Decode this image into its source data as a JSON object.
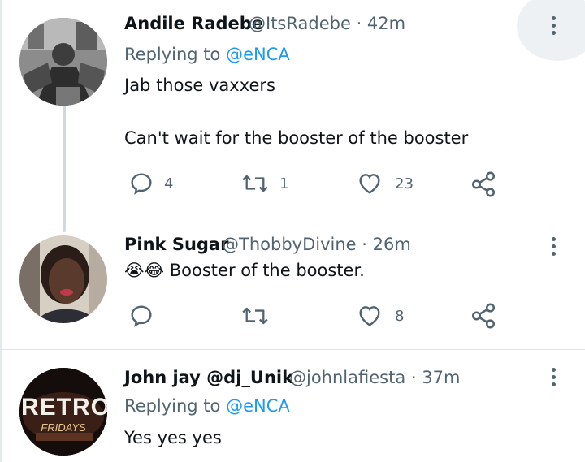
{
  "colors": {
    "text": "#0f1419",
    "secondary": "#536471",
    "link": "#1d9bf0",
    "divider": "#dfe4e7"
  },
  "tweets": [
    {
      "name": "Andile Radebe",
      "handle": "@ItsRadebe",
      "time": "· 42m",
      "replying_label": "Replying to",
      "replying_to": "@eNCA",
      "lines": [
        "Jab those vaxxers",
        "Can't wait for the booster of the booster"
      ],
      "reply_count": "4",
      "retweet_count": "1",
      "like_count": "23"
    },
    {
      "name": "Pink Sugar",
      "handle": "@ThobbyDivine",
      "time": "· 26m",
      "emoji": "😭😂",
      "text": "Booster of the booster.",
      "like_count": "8"
    },
    {
      "name": "John jay @dj_Unik",
      "handle": "@johnlafiesta",
      "time": "· 37m",
      "replying_label": "Replying to",
      "replying_to": "@eNCA",
      "text": "Yes yes yes",
      "avatar_text": "RETRO",
      "avatar_subtext": "FRIDAYS"
    }
  ]
}
